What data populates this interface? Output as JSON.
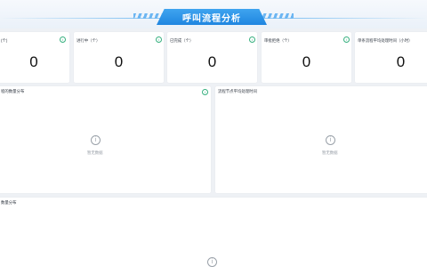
{
  "header": {
    "title": "呼叫流程分析"
  },
  "stats": [
    {
      "label": "(个)",
      "value": "0"
    },
    {
      "label": "进行中（个）",
      "value": "0"
    },
    {
      "label": "已完成（个）",
      "value": "0"
    },
    {
      "label": "审批拒绝（个）",
      "value": "0"
    },
    {
      "label": "单条流程平均处理时间（小时）",
      "value": "0"
    }
  ],
  "panels": {
    "left_mid": {
      "label": "程的数量分布",
      "empty_text": "暂无数据"
    },
    "right_mid": {
      "label": "流程节点平均处理时间",
      "empty_text": "暂无数据"
    },
    "bottom": {
      "label": "数量分布"
    }
  },
  "icons": {
    "info": "info-circle-icon",
    "empty": "empty-info-icon"
  },
  "colors": {
    "accent": "#1f86e0",
    "info_icon": "#36b07f",
    "muted": "#9aa1a9"
  }
}
